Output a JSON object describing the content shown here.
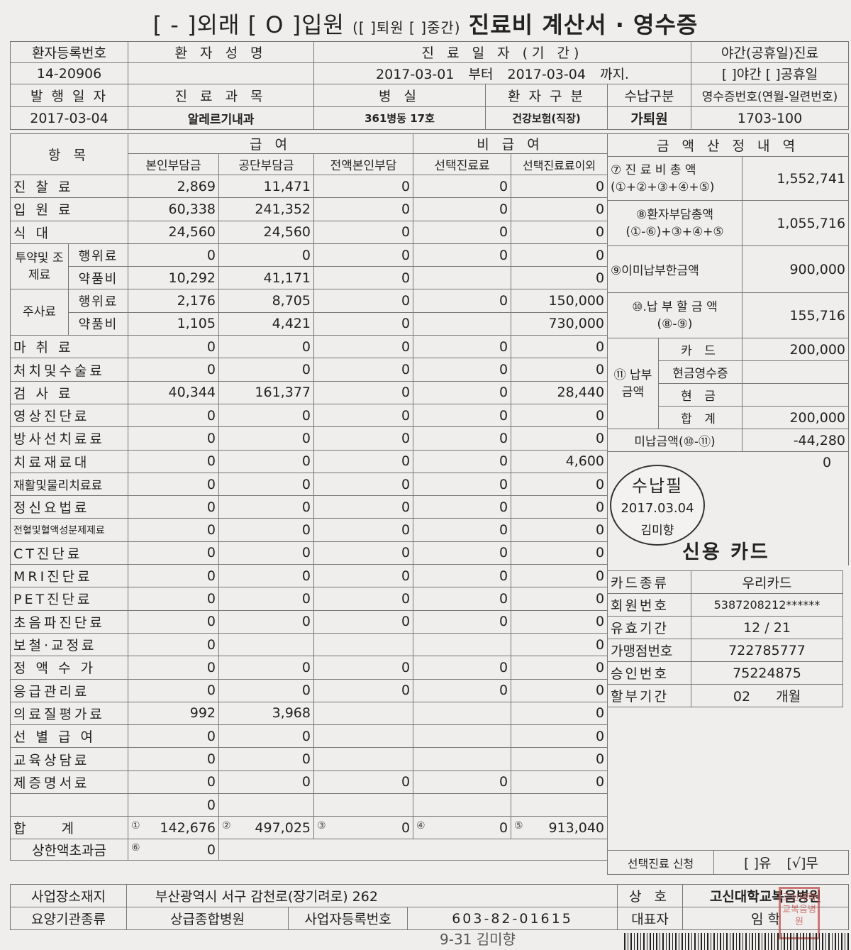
{
  "title": {
    "outpatient_check": "[ - ]외래",
    "inpatient_check": "[ O ]입원",
    "discharge_mid": "([ ]퇴원 [ ]중간)",
    "main": "진료비 계산서 · 영수증"
  },
  "header": {
    "reg_no_label": "환자등록번호",
    "name_label": "환 자 성 명",
    "period_label": "진 료 일 자 (기 간)",
    "night_label": "야간(공휴일)진료",
    "reg_no": "14-20906",
    "name": "",
    "date_from": "2017-03-01",
    "from_word": "부터",
    "date_to": "2017-03-04",
    "to_word": "까지.",
    "night_options": "[ ]야간 [ ]공휴일",
    "issue_label": "발 행 일 자",
    "dept_label": "진 료 과 목",
    "ward_label": "병 실",
    "ptype_label": "환 자 구 분",
    "paytype_label": "수납구분",
    "receipt_label": "영수증번호(연월-일련번호)",
    "issue_date": "2017-03-04",
    "dept": "알레르기내과",
    "ward": "361병동 17호",
    "ptype": "건강보험(직장)",
    "paytype": "가퇴원",
    "receipt_no": "1703-100"
  },
  "columns": {
    "item": "항 목",
    "covered": "급 여",
    "noncovered": "비 급 여",
    "calc": "금 액 산 정 내 역",
    "self": "본인부담금",
    "public": "공단부담금",
    "full_self": "전액본인부담",
    "selective": "선택진료료",
    "other": "선택진료료이외"
  },
  "rows": [
    {
      "label": "진 찰 료",
      "self": "2,869",
      "public": "11,471",
      "full": "0",
      "sel": "0",
      "other": "0"
    },
    {
      "label": "입 원 료",
      "self": "60,338",
      "public": "241,352",
      "full": "0",
      "sel": "0",
      "other": "0"
    },
    {
      "label": "식 대",
      "self": "24,560",
      "public": "24,560",
      "full": "0",
      "sel": "0",
      "other": "0"
    },
    {
      "group": "투약및 조제료",
      "label": "행위료",
      "self": "0",
      "public": "0",
      "full": "0",
      "sel": "0",
      "other": "0"
    },
    {
      "label": "약품비",
      "self": "10,292",
      "public": "41,171",
      "full": "0",
      "sel": "",
      "other": "0"
    },
    {
      "group": "주사료",
      "label": "행위료",
      "self": "2,176",
      "public": "8,705",
      "full": "0",
      "sel": "0",
      "other": "150,000"
    },
    {
      "label": "약품비",
      "self": "1,105",
      "public": "4,421",
      "full": "0",
      "sel": "",
      "other": "730,000"
    },
    {
      "label": "마 취 료",
      "self": "0",
      "public": "0",
      "full": "0",
      "sel": "0",
      "other": "0"
    },
    {
      "label": "처치및수술료",
      "self": "0",
      "public": "0",
      "full": "0",
      "sel": "0",
      "other": "0"
    },
    {
      "label": "검 사 료",
      "self": "40,344",
      "public": "161,377",
      "full": "0",
      "sel": "0",
      "other": "28,440"
    },
    {
      "label": "영상진단료",
      "self": "0",
      "public": "0",
      "full": "0",
      "sel": "0",
      "other": "0"
    },
    {
      "label": "방사선치료료",
      "self": "0",
      "public": "0",
      "full": "0",
      "sel": "0",
      "other": "0"
    },
    {
      "label": "치료재료대",
      "self": "0",
      "public": "0",
      "full": "0",
      "sel": "0",
      "other": "4,600"
    },
    {
      "label": "재활및물리치료료",
      "self": "0",
      "public": "0",
      "full": "0",
      "sel": "0",
      "other": "0"
    },
    {
      "label": "정신요법료",
      "self": "0",
      "public": "0",
      "full": "0",
      "sel": "0",
      "other": "0"
    },
    {
      "label": "전혈및혈액성분제제료",
      "self": "0",
      "public": "0",
      "full": "0",
      "sel": "0",
      "other": "0"
    },
    {
      "label": "CT진단료",
      "self": "0",
      "public": "0",
      "full": "0",
      "sel": "0",
      "other": "0"
    },
    {
      "label": "MRI진단료",
      "self": "0",
      "public": "0",
      "full": "0",
      "sel": "0",
      "other": "0"
    },
    {
      "label": "PET진단료",
      "self": "0",
      "public": "0",
      "full": "0",
      "sel": "0",
      "other": "0"
    },
    {
      "label": "초음파진단료",
      "self": "0",
      "public": "0",
      "full": "0",
      "sel": "0",
      "other": "0"
    },
    {
      "label": "보철·교정료",
      "self": "0",
      "public": "",
      "full": "",
      "sel": "",
      "other": "0"
    },
    {
      "label": "정 액 수 가",
      "self": "0",
      "public": "0",
      "full": "0",
      "sel": "0",
      "other": "0"
    },
    {
      "label": "응급관리료",
      "self": "0",
      "public": "0",
      "full": "0",
      "sel": "0",
      "other": "0"
    },
    {
      "label": "의료질평가료",
      "self": "992",
      "public": "3,968",
      "full": "",
      "sel": "",
      "other": "0"
    },
    {
      "label": "선 별 급 여",
      "self": "0",
      "public": "0",
      "full": "",
      "sel": "",
      "other": "0"
    },
    {
      "label": "교육상담료",
      "self": "0",
      "public": "0",
      "full": "",
      "sel": "",
      "other": "0"
    },
    {
      "label": "제증명서료",
      "self": "0",
      "public": "0",
      "full": "0",
      "sel": "0",
      "other": "0"
    },
    {
      "label": "",
      "self": "0",
      "public": "",
      "full": "",
      "sel": "",
      "other": ""
    }
  ],
  "totals": {
    "label": "합 계",
    "m1": "①",
    "self": "142,676",
    "m2": "②",
    "public": "497,025",
    "m3": "③",
    "full": "0",
    "m4": "④",
    "sel": "0",
    "m5": "⑤",
    "other": "913,040",
    "upper_label": "상한액초과금",
    "m6": "⑥",
    "upper": "0"
  },
  "calc": {
    "total_label": "⑦ 진 료 비 총 액",
    "total_formula": "(①+②+③+④+⑤)",
    "total": "1,552,741",
    "patient_label": "⑧환자부담총액",
    "patient_formula": "(①-⑥)+③+④+⑤",
    "patient": "1,055,716",
    "prepaid_label": "⑨이미납부한금액",
    "prepaid": "900,000",
    "due_label": "⑩.납 부 할 금 액",
    "due_formula": "(⑧-⑨)",
    "due": "155,716",
    "paid_group": "⑪ 납부 금액",
    "card_label": "카 드",
    "card": "200,000",
    "cashreceipt_label": "현금영수증",
    "cashreceipt": "",
    "cash_label": "현 금",
    "cash": "",
    "sum_label": "합 계",
    "sum": "200,000",
    "unpaid_label": "미납금액(⑩-⑪)",
    "unpaid": "-44,280",
    "zero": "0"
  },
  "stamp": {
    "line1": "수납필",
    "line2": "2017.03.04",
    "line3": "김미향"
  },
  "card": {
    "title": "신용 카드",
    "type_label": "카드종류",
    "type": "우리카드",
    "member_label": "회원번호",
    "member": "5387208212******",
    "expiry_label": "유효기간",
    "expiry": "12 / 21",
    "merchant_label": "가맹점번호",
    "merchant": "722785777",
    "approval_label": "승인번호",
    "approval": "75224875",
    "install_label": "할부기간",
    "install": "02",
    "install_unit": "개월"
  },
  "selective": {
    "label": "선택진료 신청",
    "yes": "[ ]유",
    "no": "[√]무"
  },
  "footer": {
    "addr_label": "사업장소재지",
    "addr": "부산광역시 서구 감천로(장기려로) 262",
    "shop_label": "상 호",
    "shop": "고신대학교복음병원",
    "type_label": "요양기관종류",
    "type": "상급종합병원",
    "bizno_label": "사업자등록번호",
    "bizno": "603-82-01615",
    "rep_label": "대표자",
    "rep": "임 학"
  },
  "seal_text": "고신대학교복음병원",
  "signature": "9-31 김미향"
}
